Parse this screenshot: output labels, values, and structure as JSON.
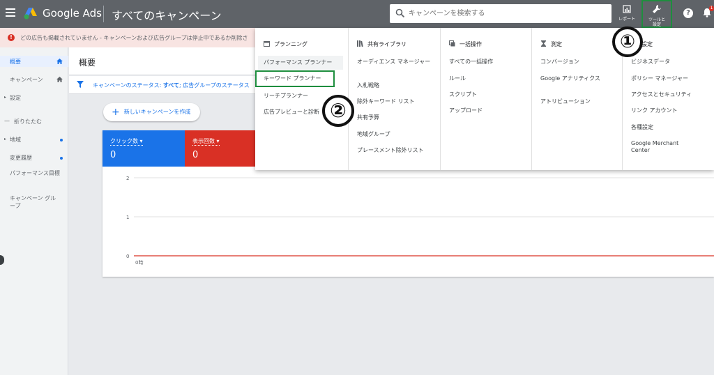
{
  "topbar": {
    "brand": "Google Ads",
    "page_title": "すべてのキャンペーン",
    "search_placeholder": "キャンペーンを検索する",
    "reports_label": "レポート",
    "tools_label_1": "ツールと",
    "tools_label_2": "設定",
    "help_glyph": "?",
    "notif_count": "1"
  },
  "notice": {
    "text": "どの広告も掲載されていません - キャンペーンおよび広告グループは停止中であるか削除さ"
  },
  "sidebar": {
    "items": [
      {
        "label": "概要"
      },
      {
        "label": "キャンペーン"
      },
      {
        "label": "設定"
      },
      {
        "label": "折りたたむ"
      },
      {
        "label": "地域"
      },
      {
        "label": "変更履歴"
      },
      {
        "label": "パフォーマンス目標"
      },
      {
        "label": "キャンペーン グループ"
      }
    ]
  },
  "main": {
    "title": "概要",
    "filter_prefix": "キャンペーンのステータス:",
    "filter_value": "すべて",
    "filter_suffix": "; 広告グループのステータス",
    "new_campaign": "新しいキャンペーンを作成",
    "metrics": [
      {
        "label": "クリック数",
        "value": "0",
        "color": "#1a73e8"
      },
      {
        "label": "表示回数",
        "value": "0",
        "color": "#d93025"
      }
    ]
  },
  "tools_menu": {
    "columns": [
      {
        "heading": "プランニング",
        "items": [
          "パフォーマンス プランナー",
          "キーワード プランナー",
          "リーチプランナー",
          "広告プレビューと診断"
        ]
      },
      {
        "heading": "共有ライブラリ",
        "items": [
          "オーディエンス マネージャー",
          "入札戦略",
          "除外キーワード リスト",
          "共有予算",
          "地域グループ",
          "プレースメント除外リスト"
        ]
      },
      {
        "heading": "一括操作",
        "items": [
          "すべての一括操作",
          "ルール",
          "スクリプト",
          "アップロード"
        ]
      },
      {
        "heading": "測定",
        "items": [
          "コンバージョン",
          "Google アナリティクス",
          "アトリビューション"
        ]
      },
      {
        "heading": "設定",
        "items": [
          "ビジネスデータ",
          "ポリシー マネージャー",
          "アクセスとセキュリティ",
          "リンク アカウント",
          "各種設定",
          "Google Merchant Center"
        ]
      }
    ]
  },
  "annotations": {
    "one": "①",
    "two": "②"
  },
  "chart_data": {
    "type": "line",
    "x": [
      "0時"
    ],
    "series": [
      {
        "values": [
          0
        ]
      }
    ],
    "ylim": [
      0,
      2
    ],
    "yticks": [
      "0",
      "1",
      "2"
    ],
    "xticks": [
      "0時"
    ],
    "grid": true,
    "line_color": "#d93025"
  }
}
